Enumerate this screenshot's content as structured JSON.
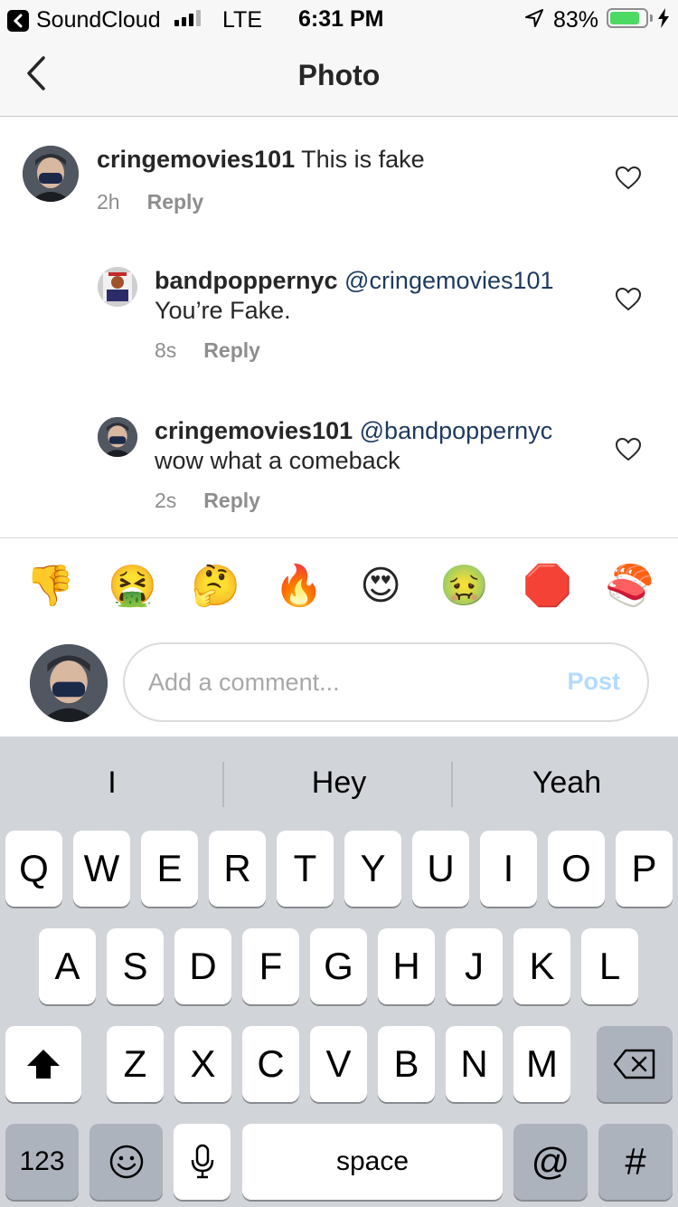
{
  "status_bar": {
    "back_app": "SoundCloud",
    "carrier": "LTE",
    "time": "6:31 PM",
    "battery_percent": "83%",
    "battery_level": 0.83
  },
  "nav": {
    "title": "Photo",
    "back_icon": "chevron-left-icon"
  },
  "comments": [
    {
      "username": "cringemovies101",
      "mention": "",
      "text": " This is fake",
      "time": "2h",
      "reply_label": "Reply"
    },
    {
      "username": "bandpoppernyc",
      "mention": "@cringemovies101",
      "text": "You’re Fake.",
      "time": "8s",
      "reply_label": "Reply"
    },
    {
      "username": "cringemovies101",
      "mention": "@bandpoppernyc",
      "text": "wow what a comeback",
      "time": "2s",
      "reply_label": "Reply"
    }
  ],
  "emoji_bar": [
    "👎",
    "🤮",
    "🤔",
    "🔥",
    "😍",
    "🤢",
    "🛑",
    "🍣"
  ],
  "composer": {
    "placeholder": "Add a comment...",
    "post_label": "Post"
  },
  "keyboard": {
    "suggestions": [
      "I",
      "Hey",
      "Yeah"
    ],
    "row1": [
      "Q",
      "W",
      "E",
      "R",
      "T",
      "Y",
      "U",
      "I",
      "O",
      "P"
    ],
    "row2": [
      "A",
      "S",
      "D",
      "F",
      "G",
      "H",
      "J",
      "K",
      "L"
    ],
    "row3": [
      "Z",
      "X",
      "C",
      "V",
      "B",
      "N",
      "M"
    ],
    "numbers_label": "123",
    "space_label": "space",
    "at_label": "@",
    "hash_label": "#"
  },
  "colors": {
    "accent_link": "#1e3a5f",
    "post_disabled": "#b3dbff",
    "battery": "#4cd964"
  }
}
